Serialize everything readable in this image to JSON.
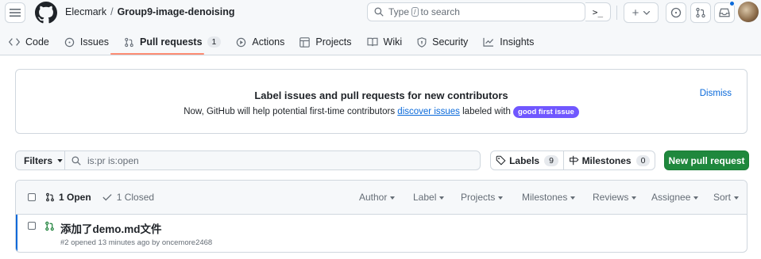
{
  "header": {
    "owner": "Elecmark",
    "separator": "/",
    "repo": "Group9-image-denoising",
    "search_prefix": "Type",
    "search_key": "/",
    "search_suffix": "to search",
    "command_palette": ">_",
    "plus_label": "+"
  },
  "tabs": [
    {
      "label": "Code"
    },
    {
      "label": "Issues"
    },
    {
      "label": "Pull requests",
      "count": "1"
    },
    {
      "label": "Actions"
    },
    {
      "label": "Projects"
    },
    {
      "label": "Wiki"
    },
    {
      "label": "Security"
    },
    {
      "label": "Insights"
    }
  ],
  "banner": {
    "title": "Label issues and pull requests for new contributors",
    "desc_before": "Now, GitHub will help potential first-time contributors ",
    "desc_link": "discover issues",
    "desc_after": " labeled with ",
    "label": "good first issue",
    "dismiss": "Dismiss"
  },
  "filters": {
    "button": "Filters",
    "query": "is:pr is:open",
    "labels": "Labels",
    "labels_count": "9",
    "milestones": "Milestones",
    "milestones_count": "0",
    "new_pr": "New pull request"
  },
  "list": {
    "open": "1 Open",
    "closed": "1 Closed",
    "sort_menus": [
      "Author",
      "Label",
      "Projects",
      "Milestones",
      "Reviews",
      "Assignee",
      "Sort"
    ],
    "items": [
      {
        "title": "添加了demo.md文件",
        "meta": "#2 opened 13 minutes ago by oncemore2468"
      }
    ]
  },
  "colors": {
    "accent": "#0969da",
    "primary_button": "#1f883d",
    "tab_underline": "#fd8c73",
    "label_bg": "#7057ff",
    "open_icon": "#1a7f37"
  }
}
